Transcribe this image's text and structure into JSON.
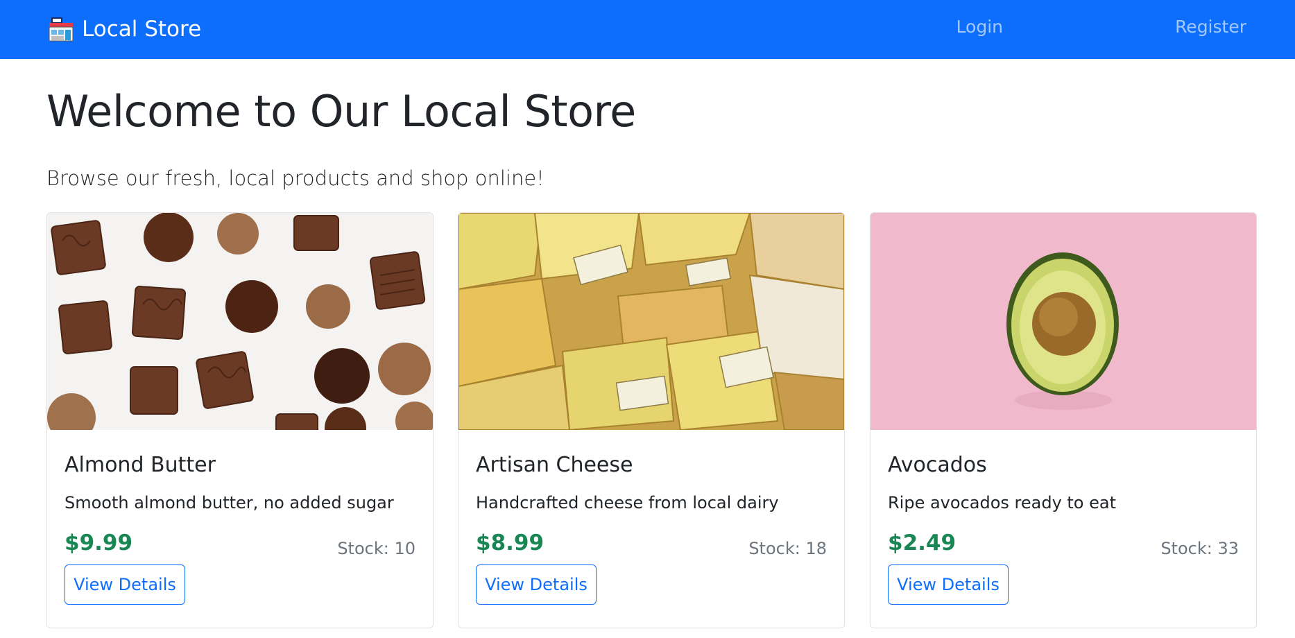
{
  "navbar": {
    "brand_icon": "store-icon",
    "brand": "Local Store",
    "links": [
      "Login",
      "Register"
    ],
    "bg_color": "#0d6efd"
  },
  "main": {
    "title": "Welcome to Our Local Store",
    "lead": "Browse our fresh, local products and shop online!"
  },
  "products": [
    {
      "image": "chocolates-photo",
      "name": "Almond Butter",
      "description": "Smooth almond butter, no added sugar",
      "price": "$9.99",
      "stock": "Stock: 10",
      "button": "View Details"
    },
    {
      "image": "cheese-photo",
      "name": "Artisan Cheese",
      "description": "Handcrafted cheese from local dairy",
      "price": "$8.99",
      "stock": "Stock: 18",
      "button": "View Details"
    },
    {
      "image": "avocado-photo",
      "name": "Avocados",
      "description": "Ripe avocados ready to eat",
      "price": "$2.49",
      "stock": "Stock: 33",
      "button": "View Details"
    }
  ],
  "colors": {
    "price": "#198754",
    "button": "#0d6efd",
    "muted": "#6c757d"
  }
}
